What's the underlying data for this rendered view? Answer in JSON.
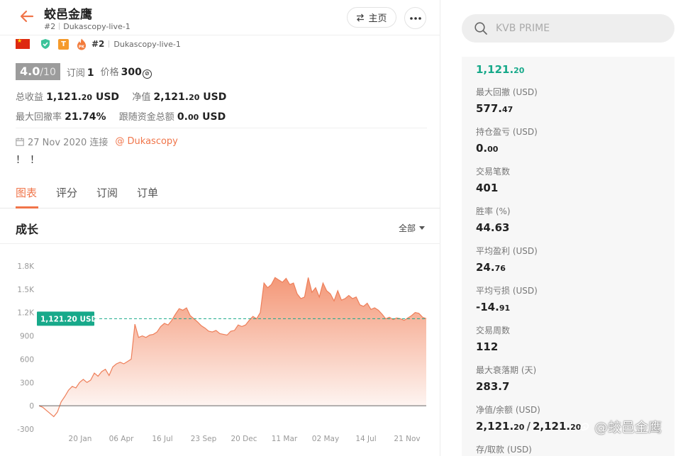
{
  "header": {
    "title": "蛟邑金鹰",
    "rank": "#2",
    "server": "Dukascopy-live-1",
    "home_label": "主页"
  },
  "badges": {
    "t_label": "T",
    "pk_label": "PK",
    "rank": "#2",
    "server": "Dukascopy-live-1"
  },
  "score": {
    "value": "4.0",
    "max": "/10",
    "subscribe_label": "订阅",
    "subscribe_count": "1",
    "price_label": "价格",
    "price_value": "300",
    "coin_symbol": "⊘"
  },
  "stats": {
    "total_profit_label": "总收益",
    "total_profit_int": "1,121.",
    "total_profit_dec": "20",
    "total_profit_unit": "USD",
    "equity_label": "净值",
    "equity_int": "2,121.",
    "equity_dec": "20",
    "equity_unit": "USD",
    "max_drawdown_label": "最大回撤率",
    "max_drawdown_value": "21.74%",
    "follow_funds_label": "跟随资金总额",
    "follow_funds_int": "0.",
    "follow_funds_dec": "00",
    "follow_funds_unit": "USD"
  },
  "meta": {
    "date": "27 Nov 2020 连接",
    "broker": "@ Dukascopy",
    "note": "！！"
  },
  "tabs": [
    {
      "label": "图表",
      "active": true
    },
    {
      "label": "评分",
      "active": false
    },
    {
      "label": "订阅",
      "active": false
    },
    {
      "label": "订单",
      "active": false
    }
  ],
  "growth": {
    "title": "成长",
    "range": "全部"
  },
  "chart_data": {
    "type": "area",
    "y_ticks": [
      "1.8K",
      "1.5K",
      "1.2K",
      "900",
      "600",
      "300",
      "0",
      "-300"
    ],
    "x_ticks": [
      "20 Jan",
      "06 Apr",
      "16 Jul",
      "23 Sep",
      "20 Dec",
      "11 Mar",
      "02 May",
      "14 Jul",
      "21 Nov"
    ],
    "ylim": [
      -300,
      1800
    ],
    "current_label": "1,121.20 USD",
    "current_value": 1121.2,
    "series": [
      {
        "values": [
          0,
          -20,
          -60,
          -100,
          -140,
          -80,
          50,
          120,
          200,
          250,
          230,
          300,
          340,
          300,
          330,
          420,
          380,
          440,
          470,
          390,
          500,
          540,
          560,
          540,
          570,
          600,
          1050,
          880,
          900,
          880,
          910,
          920,
          950,
          1020,
          1060,
          1040,
          1100,
          1180,
          1250,
          1230,
          1260,
          1160,
          1120,
          1080,
          1030,
          1000,
          960,
          950,
          970,
          930,
          920,
          910,
          960,
          970,
          1040,
          1020,
          1040,
          1100,
          1150,
          1120,
          1200,
          1580,
          1520,
          1560,
          1650,
          1620,
          1590,
          1640,
          1560,
          1580,
          1440,
          1380,
          1400,
          1650,
          1460,
          1520,
          1400,
          1580,
          1480,
          1440,
          1350,
          1480,
          1360,
          1380,
          1420,
          1380,
          1400,
          1300,
          1280,
          1320,
          1240,
          1260,
          1230,
          1180,
          1120,
          1140,
          1110,
          1130,
          1120,
          1100,
          1130,
          1160,
          1200,
          1190,
          1140,
          1121.2
        ]
      }
    ]
  },
  "search": {
    "placeholder": "KVB PRIME"
  },
  "metrics": {
    "balance_int": "1,121.",
    "balance_dec": "20",
    "items": [
      {
        "label": "最大回撤 (USD)",
        "int": "577.",
        "dec": "47"
      },
      {
        "label": "持仓盈亏 (USD)",
        "int": "0.",
        "dec": "00"
      },
      {
        "label": "交易笔数",
        "int": "401",
        "dec": ""
      },
      {
        "label": "胜率 (%)",
        "int": "44.63",
        "dec": ""
      },
      {
        "label": "平均盈利 (USD)",
        "int": "24.",
        "dec": "76"
      },
      {
        "label": "平均亏损 (USD)",
        "int": "-14.",
        "dec": "91"
      },
      {
        "label": "交易周数",
        "int": "112",
        "dec": ""
      },
      {
        "label": "最大衰落期 (天)",
        "int": "283.7",
        "dec": ""
      }
    ],
    "equity_label": "净值/余额 (USD)",
    "equity_int": "2,121.",
    "equity_dec": "20",
    "balance2_int": "2,121.",
    "balance2_dec": "20",
    "deposit_label": "存/取款 (USD)"
  },
  "watermark": "@蛟邑金鹰",
  "colors": {
    "accent": "#f0754a",
    "green": "#17a98a"
  }
}
